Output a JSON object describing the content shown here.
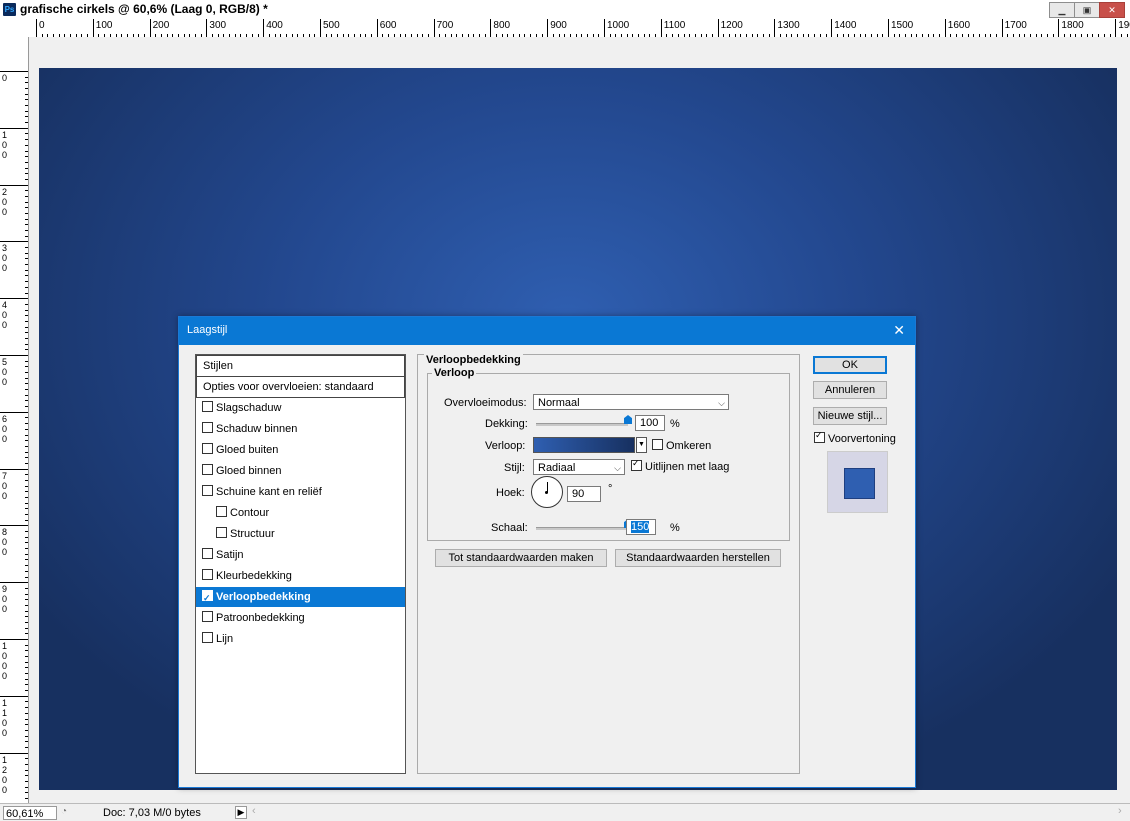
{
  "window": {
    "title": "grafische cirkels @ 60,6% (Laag 0, RGB/8) *",
    "app_icon": "Ps"
  },
  "ruler_top_labels": [
    "0",
    "100",
    "200",
    "300",
    "400",
    "500",
    "600",
    "700",
    "800",
    "900",
    "1000",
    "1100",
    "1200",
    "1300",
    "1400",
    "1500",
    "1600",
    "1700",
    "1800",
    "190"
  ],
  "ruler_left_labels": [
    "0",
    "100",
    "200",
    "300",
    "400",
    "500",
    "600",
    "700",
    "800",
    "900",
    "1000",
    "1100",
    "1200"
  ],
  "status": {
    "zoom": "60,61%",
    "doc": "Doc: 7,03 M/0 bytes"
  },
  "dialog": {
    "title": "Laagstijl",
    "list": {
      "header": "Stijlen",
      "blend_options": "Opties voor overvloeien: standaard",
      "items": [
        {
          "label": "Slagschaduw",
          "checked": false
        },
        {
          "label": "Schaduw binnen",
          "checked": false
        },
        {
          "label": "Gloed buiten",
          "checked": false
        },
        {
          "label": "Gloed binnen",
          "checked": false
        },
        {
          "label": "Schuine kant en reliëf",
          "checked": false
        },
        {
          "label": "Contour",
          "checked": false
        },
        {
          "label": "Structuur",
          "checked": false
        },
        {
          "label": "Satijn",
          "checked": false
        },
        {
          "label": "Kleurbedekking",
          "checked": false
        },
        {
          "label": "Verloopbedekking",
          "checked": true
        },
        {
          "label": "Patroonbedekking",
          "checked": false
        },
        {
          "label": "Lijn",
          "checked": false
        }
      ]
    },
    "section_title": "Verloopbedekking",
    "group_title": "Verloop",
    "blend_mode_label": "Overvloeimodus:",
    "blend_mode_value": "Normaal",
    "opacity_label": "Dekking:",
    "opacity_value": "100",
    "opacity_unit": "%",
    "opacity_fraction": 1.0,
    "gradient_label": "Verloop:",
    "reverse_label": "Omkeren",
    "style_label": "Stijl:",
    "style_value": "Radiaal",
    "align_label": "Uitlijnen met laag",
    "angle_label": "Hoek:",
    "angle_value": "90",
    "angle_unit": "°",
    "scale_label": "Schaal:",
    "scale_value": "150",
    "scale_unit": "%",
    "scale_fraction": 1.0,
    "make_default": "Tot standaardwaarden maken",
    "reset_default": "Standaardwaarden herstellen",
    "ok": "OK",
    "cancel": "Annuleren",
    "new_style": "Nieuwe stijl...",
    "preview_label": "Voorvertoning",
    "accent_color": "#0a78d4",
    "gradient_colors": [
      "#2f5fb1",
      "#173060"
    ]
  }
}
